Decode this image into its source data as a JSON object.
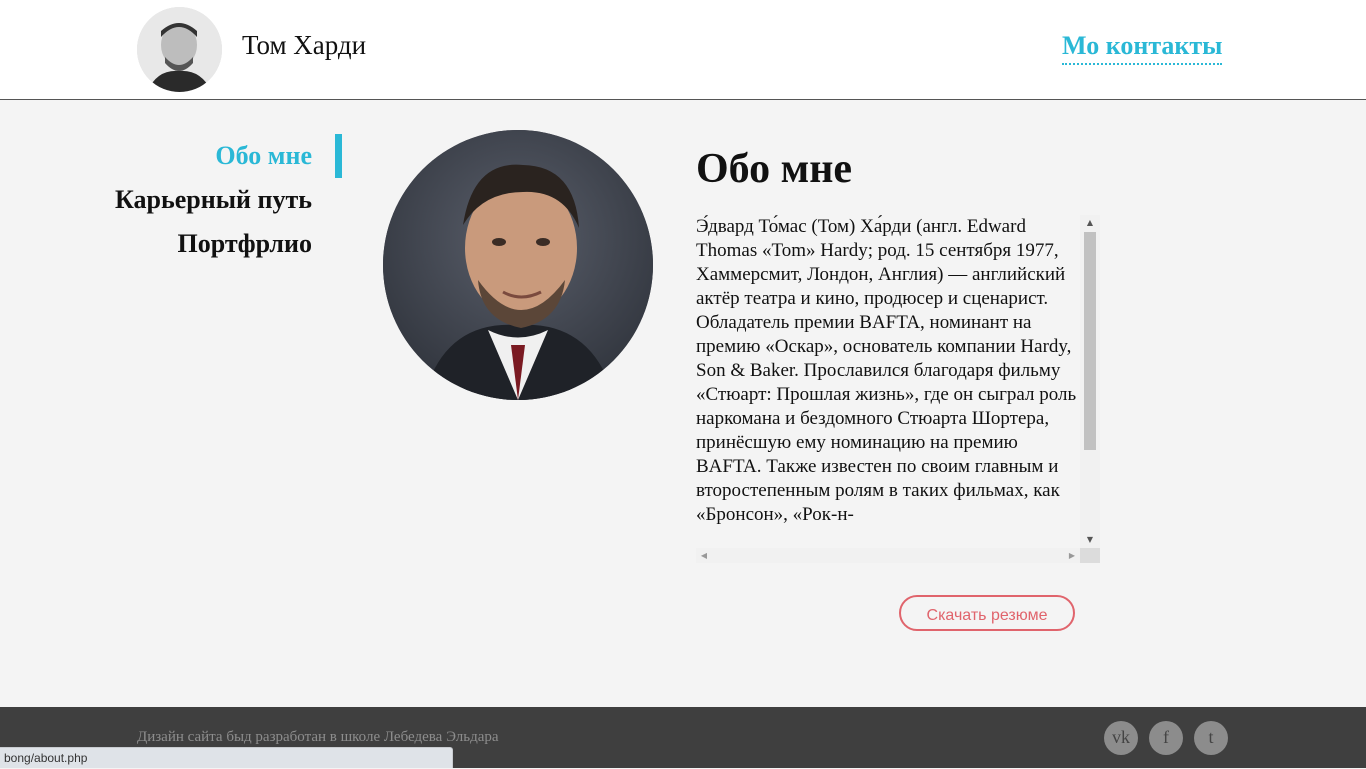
{
  "header": {
    "site_name": "Том Харди",
    "contacts_link": "Мо контакты"
  },
  "nav": {
    "items": [
      {
        "label": "Обо мне",
        "active": true
      },
      {
        "label": "Карьерный путь",
        "active": false
      },
      {
        "label": "Портфрлио",
        "active": false
      }
    ]
  },
  "main": {
    "title": "Обо мне",
    "bio": "Э́двард То́мас (Том) Ха́рди (англ. Edward Thomas «Tom» Hardy; род. 15 сентября 1977, Хаммерсмит, Лондон, Англия) — английский актёр театра и кино, продюсер и сценарист. Обладатель премии BAFTA, номинант на премию «Оскар», основатель компании Hardy, Son & Baker. Прославился благодаря фильму «Стюарт: Прошлая жизнь», где он сыграл роль наркомана и бездомного Стюарта Шортера, принёсшую ему номинацию на премию BAFTA. Также известен по своим главным и второстепенным ролям в таких фильмах, как «Бронсон», «Рок-н-",
    "resume_button": "Скачать резюме"
  },
  "footer": {
    "text": "Дизайн сайта быд разработан в школе Лебедева Эльдара",
    "social": [
      {
        "label": "vk"
      },
      {
        "label": "f"
      },
      {
        "label": "t"
      }
    ]
  },
  "status_bar": {
    "url": "bong/about.php"
  },
  "colors": {
    "accent": "#2ab8d6",
    "button": "#e0646c",
    "footer_bg": "#3f3f3f",
    "page_bg": "#f4f4f4"
  },
  "icons": [
    "scroll-up-arrow-icon",
    "scroll-down-arrow-icon",
    "scroll-left-arrow-icon",
    "scroll-right-arrow-icon"
  ]
}
